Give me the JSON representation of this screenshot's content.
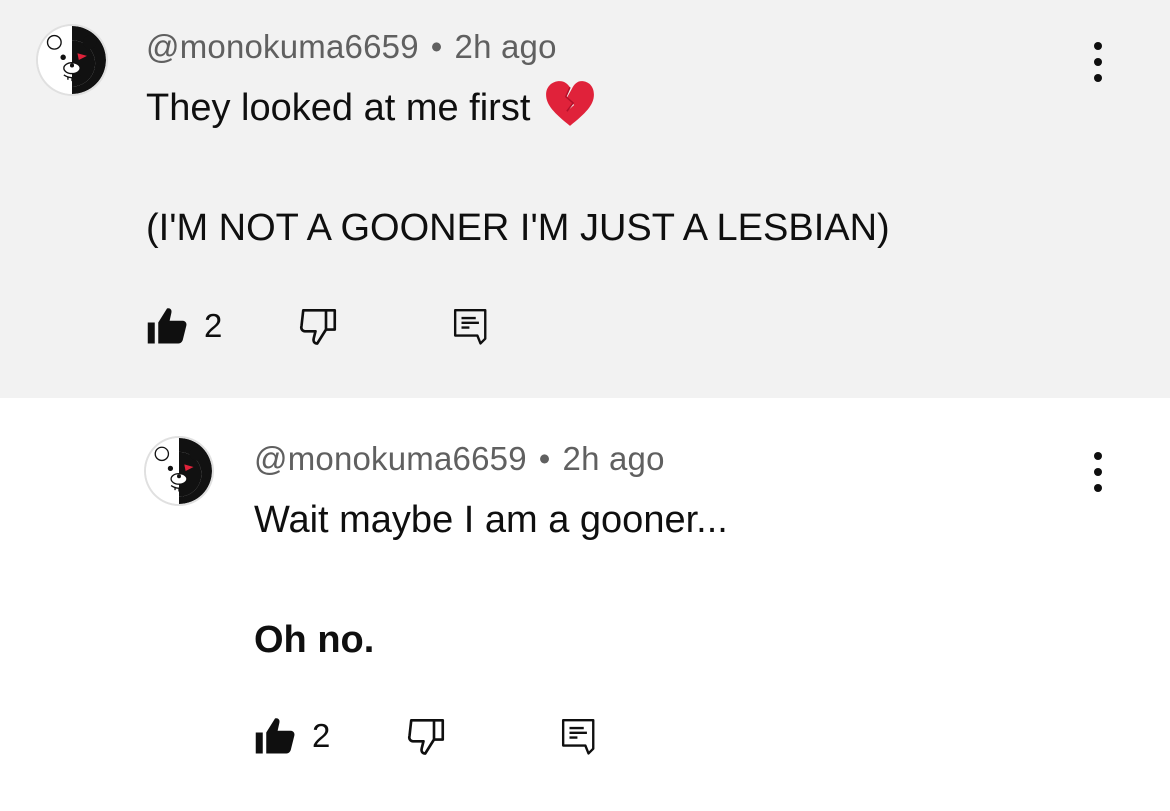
{
  "comments": [
    {
      "author": "@monokuma6659",
      "separator": "•",
      "time": "2h ago",
      "line1": "They looked at me first",
      "line1_emoji": "broken-heart-emoji",
      "line2": "(I'M NOT A GOONER I'M JUST A LESBIAN)",
      "likes": "2",
      "like_icon": "thumbs-up-filled-icon",
      "dislike_icon": "thumbs-down-icon",
      "reply_icon": "reply-icon",
      "menu_icon": "more-vertical-icon"
    },
    {
      "author": "@monokuma6659",
      "separator": "•",
      "time": "2h ago",
      "line1": "Wait maybe I am a gooner...",
      "line2": "Oh no.",
      "likes": "2",
      "like_icon": "thumbs-up-filled-icon",
      "dislike_icon": "thumbs-down-icon",
      "reply_icon": "reply-icon",
      "menu_icon": "more-vertical-icon"
    }
  ],
  "colors": {
    "top_comment_bg": "#f2f2f2",
    "reply_bg": "#ffffff",
    "text": "#0f0f0f",
    "meta_text": "#606060",
    "heart_red": "#e0223a"
  }
}
